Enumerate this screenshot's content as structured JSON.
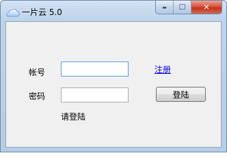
{
  "window": {
    "title": "一片云 5.0",
    "icons": {
      "app": "cloud-icon",
      "minimize": "minimize-icon",
      "maximize": "maximize-icon",
      "close": "close-icon"
    },
    "caption": {
      "minimize_glyph": "▬",
      "maximize_glyph": "☐",
      "close_glyph": "✕"
    }
  },
  "login": {
    "account_label": "帐号",
    "account_value": "",
    "password_label": "密码",
    "password_value": "",
    "register_link": "注册",
    "login_button": "登陆",
    "status_text": "请登陆"
  }
}
